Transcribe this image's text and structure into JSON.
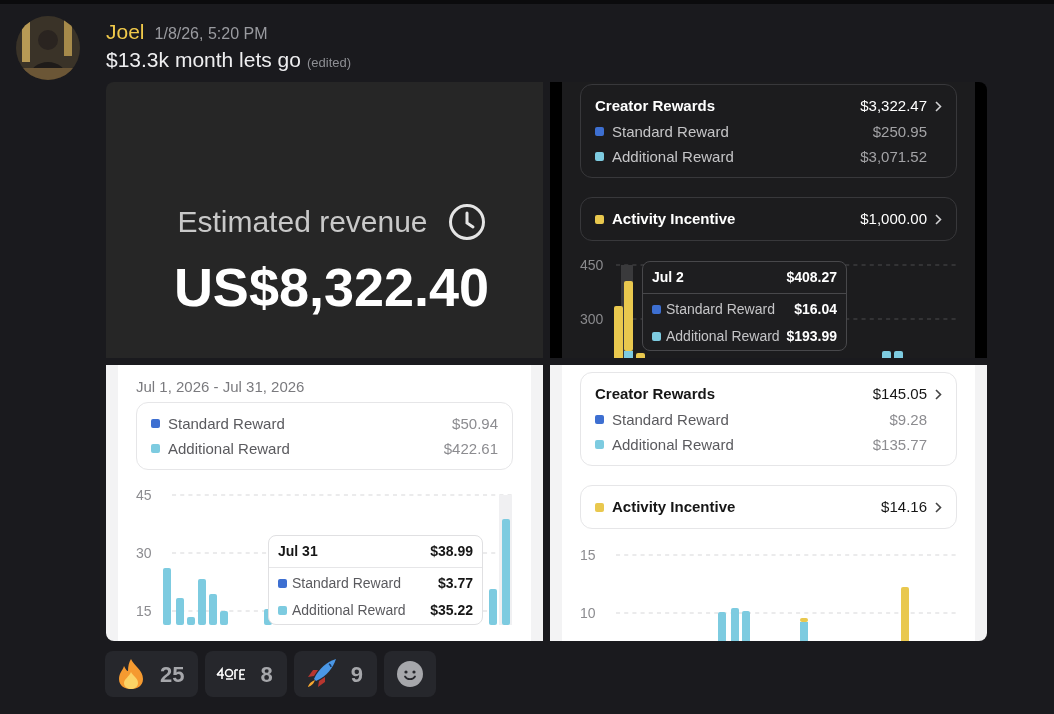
{
  "message": {
    "author": "Joel",
    "timestamp": "1/8/26, 5:20 PM",
    "text": "$13.3k month lets go",
    "edited": "(edited)"
  },
  "attachments": [
    {
      "kind": "revenue",
      "title": "Estimated revenue",
      "amount": "US$8,322.40"
    },
    {
      "kind": "dark",
      "groups": [
        {
          "title": "Creator Rewards",
          "total": "$3,322.47",
          "chevron": true,
          "items": [
            {
              "label": "Standard Reward",
              "value": "$250.95",
              "color": "#3d6fd1"
            },
            {
              "label": "Additional Reward",
              "value": "$3,071.52",
              "color": "#7dcbe0"
            }
          ]
        },
        {
          "title": "Activity Incentive",
          "total": "$1,000.00",
          "chevron": true,
          "color": "#e9c84e"
        }
      ],
      "yticks": [
        "450",
        "300"
      ],
      "tooltip": {
        "date": "Jul 2",
        "total": "$408.27",
        "items": [
          {
            "label": "Standard Reward",
            "value": "$16.04",
            "color": "#3d6fd1"
          },
          {
            "label": "Additional Reward",
            "value": "$193.99",
            "color": "#7dcbe0"
          }
        ]
      }
    },
    {
      "kind": "light",
      "date_range": "Jul 1, 2026 - Jul 31, 2026",
      "groups": [
        {
          "items": [
            {
              "label": "Standard Reward",
              "value": "$50.94",
              "color": "#3d6fd1"
            },
            {
              "label": "Additional Reward",
              "value": "$422.61",
              "color": "#7dcbe0"
            }
          ]
        }
      ],
      "yticks": [
        "45",
        "30",
        "15"
      ],
      "tooltip": {
        "date": "Jul 31",
        "total": "$38.99",
        "items": [
          {
            "label": "Standard Reward",
            "value": "$3.77",
            "color": "#3d6fd1"
          },
          {
            "label": "Additional Reward",
            "value": "$35.22",
            "color": "#7dcbe0"
          }
        ]
      }
    },
    {
      "kind": "light",
      "groups": [
        {
          "title": "Creator Rewards",
          "total": "$145.05",
          "chevron": true,
          "items": [
            {
              "label": "Standard Reward",
              "value": "$9.28",
              "color": "#3d6fd1"
            },
            {
              "label": "Additional Reward",
              "value": "$135.77",
              "color": "#7dcbe0"
            }
          ]
        },
        {
          "title": "Activity Incentive",
          "total": "$14.16",
          "chevron": true,
          "color": "#e9c84e"
        }
      ],
      "yticks": [
        "15",
        "10"
      ]
    }
  ],
  "reactions": [
    {
      "kind": "fire",
      "count": "25"
    },
    {
      "kind": "custom",
      "count": "8"
    },
    {
      "kind": "rocket",
      "count": "9"
    },
    {
      "kind": "add"
    }
  ]
}
